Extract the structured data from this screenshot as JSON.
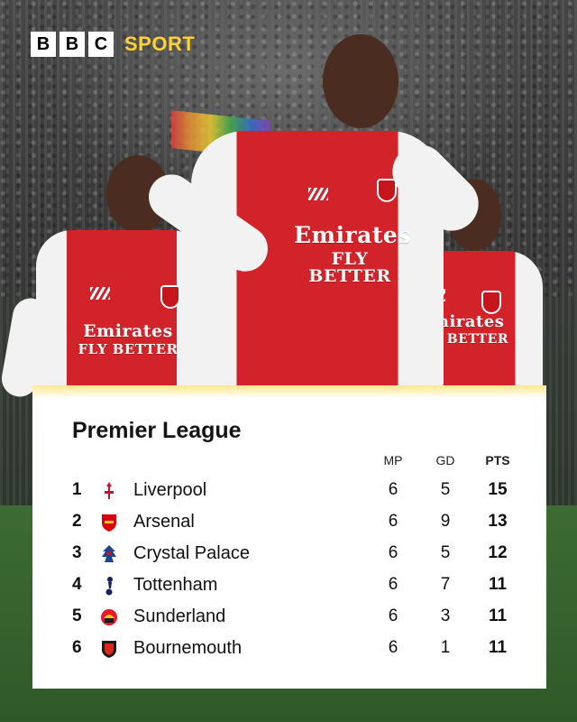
{
  "brand": {
    "letters": [
      "B",
      "B",
      "C"
    ],
    "sport": "SPORT",
    "accent_color": "#ffd230"
  },
  "photo": {
    "sponsor_line1": "Emirates",
    "sponsor_line2": "FLY BETTER",
    "kit_color": "#d2232a"
  },
  "table": {
    "title": "Premier League",
    "headers": {
      "mp": "MP",
      "gd": "GD",
      "pts": "PTS"
    },
    "rows": [
      {
        "pos": "1",
        "team": "Liverpool",
        "mp": "6",
        "gd": "5",
        "pts": "15",
        "crest": "liverpool-crest-icon",
        "crest_color": "#c8102e"
      },
      {
        "pos": "2",
        "team": "Arsenal",
        "mp": "6",
        "gd": "9",
        "pts": "13",
        "crest": "arsenal-crest-icon",
        "crest_color": "#db0007"
      },
      {
        "pos": "3",
        "team": "Crystal Palace",
        "mp": "6",
        "gd": "5",
        "pts": "12",
        "crest": "crystal-palace-crest-icon",
        "crest_color": "#1b458f"
      },
      {
        "pos": "4",
        "team": "Tottenham",
        "mp": "6",
        "gd": "7",
        "pts": "11",
        "crest": "tottenham-crest-icon",
        "crest_color": "#132257"
      },
      {
        "pos": "5",
        "team": "Sunderland",
        "mp": "6",
        "gd": "3",
        "pts": "11",
        "crest": "sunderland-crest-icon",
        "crest_color": "#eb172b"
      },
      {
        "pos": "6",
        "team": "Bournemouth",
        "mp": "6",
        "gd": "1",
        "pts": "11",
        "crest": "bournemouth-crest-icon",
        "crest_color": "#da291c"
      }
    ]
  }
}
